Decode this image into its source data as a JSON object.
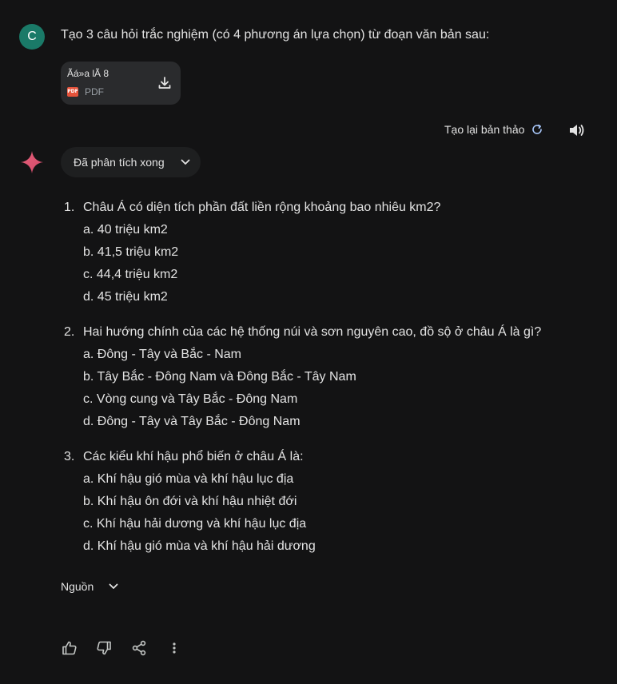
{
  "user": {
    "avatar_letter": "C",
    "prompt": "Tạo 3 câu hỏi trắc nghiệm (có 4 phương án lựa chọn) từ đoạn văn bản sau:"
  },
  "attachment": {
    "name": "Ãá»a lÃ 8",
    "type_badge": "PDF",
    "type_label": "PDF",
    "icon": "download-icon"
  },
  "toolbar": {
    "regenerate_label": "Tạo lại bản thảo",
    "regenerate_icon": "refresh-icon",
    "speaker_icon": "speaker-icon"
  },
  "response": {
    "analyzed_label": "Đã phân tích xong",
    "questions": [
      {
        "number": "1.",
        "text": "Châu Á có diện tích phần đất liền rộng khoảng bao nhiêu km2?",
        "options": [
          "a. 40 triệu km2",
          "b. 41,5 triệu km2",
          "c. 44,4 triệu km2",
          "d. 45 triệu km2"
        ]
      },
      {
        "number": "2.",
        "text": "Hai hướng chính của các hệ thống núi và sơn nguyên cao, đồ sộ ở châu Á là gì?",
        "options": [
          "a. Đông - Tây và Bắc - Nam",
          "b. Tây Bắc - Đông Nam và Đông Bắc - Tây Nam",
          "c. Vòng cung và Tây Bắc - Đông Nam",
          "d. Đông - Tây và Tây Bắc - Đông Nam"
        ]
      },
      {
        "number": "3.",
        "text": "Các kiểu khí hậu phổ biến ở châu Á là:",
        "options": [
          "a. Khí hậu gió mùa và khí hậu lục địa",
          "b. Khí hậu ôn đới và khí hậu nhiệt đới",
          "c. Khí hậu hải dương và khí hậu lục địa",
          "d. Khí hậu gió mùa và khí hậu hải dương"
        ]
      }
    ],
    "sources_label": "Nguồn"
  },
  "actions": [
    "thumbs-up-icon",
    "thumbs-down-icon",
    "share-icon",
    "more-vert-icon"
  ],
  "colors": {
    "background": "#131314",
    "avatar": "#1a7a68",
    "chip": "#2a2b2d",
    "accent_blue": "#a8c7fa"
  }
}
